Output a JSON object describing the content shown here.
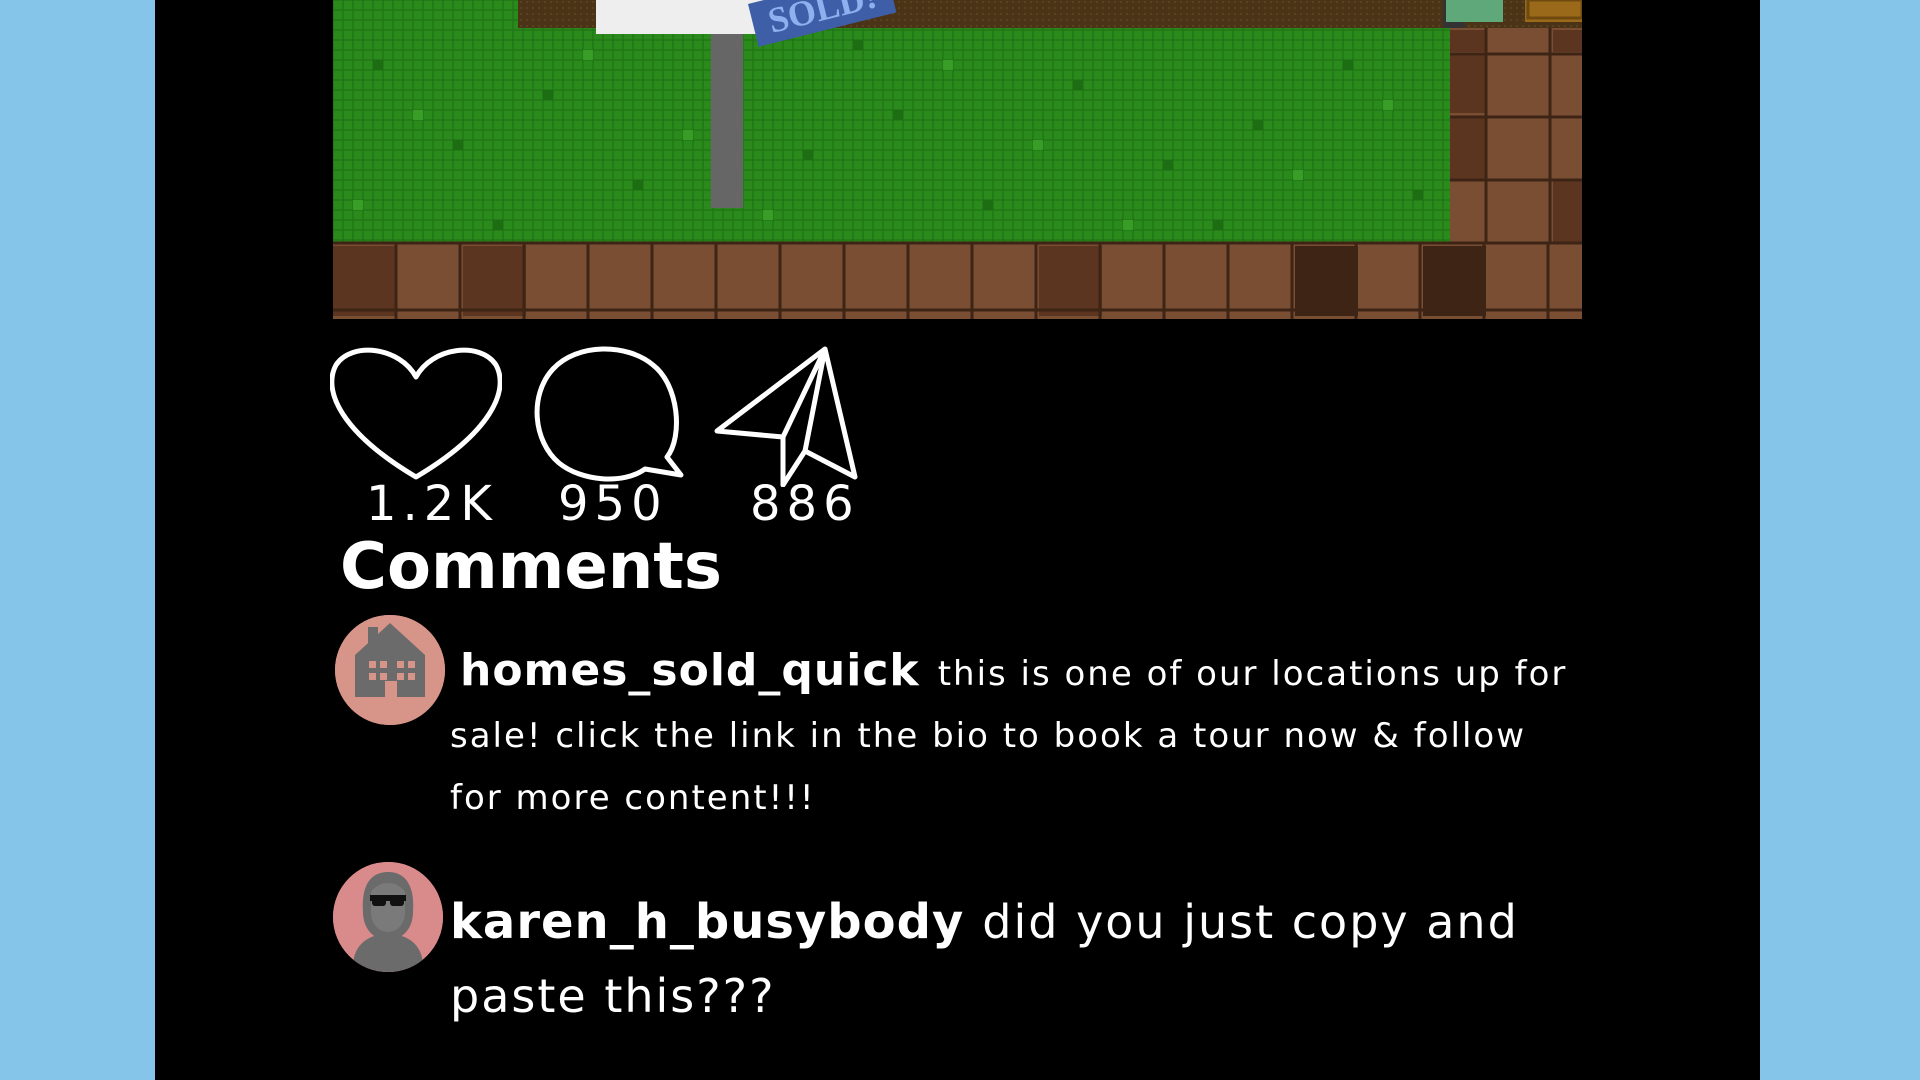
{
  "post": {
    "sign_text": "SOLD!"
  },
  "actions": {
    "likes_count": "1.2K",
    "comments_count": "950",
    "shares_count": "886"
  },
  "comments_section": {
    "heading": "Comments",
    "items": [
      {
        "username": "homes_sold_quick",
        "text": "this is one of our locations up for sale! click the link in the bio to book a tour now & follow for more content!!!",
        "avatar_icon": "house-icon",
        "avatar_color": "#d7958a"
      },
      {
        "username": "karen_h_busybody",
        "text": "did you just copy and paste this???",
        "avatar_icon": "woman-sunglasses-icon",
        "avatar_color": "#d98a8a"
      }
    ]
  },
  "colors": {
    "background": "#85c5ea",
    "panel": "#000000",
    "text": "#ffffff",
    "grass": "#2f8f1f",
    "path": "#7a4e33"
  }
}
